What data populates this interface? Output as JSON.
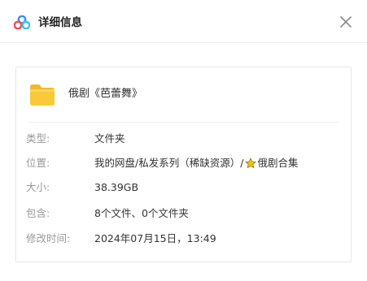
{
  "dialog": {
    "title": "详细信息",
    "icons": {
      "app_logo": "baidu-netdisk-logo-icon",
      "close": "close-icon"
    }
  },
  "file": {
    "name": "俄剧《芭蕾舞》",
    "icon": "folder-icon",
    "folder_color": "#f8c938"
  },
  "details": {
    "type": {
      "label": "类型:",
      "value": "文件夹"
    },
    "location": {
      "label": "位置:",
      "path_prefix": "我的网盘/私发系列（稀缺资源）/",
      "path_icon": "star-icon",
      "path_suffix": "俄剧合集"
    },
    "size": {
      "label": "大小:",
      "value": "38.39GB"
    },
    "contains": {
      "label": "包含:",
      "value": "8个文件、0个文件夹"
    },
    "modified": {
      "label": "修改时间:",
      "value": "2024年07月15日，13:49"
    }
  }
}
